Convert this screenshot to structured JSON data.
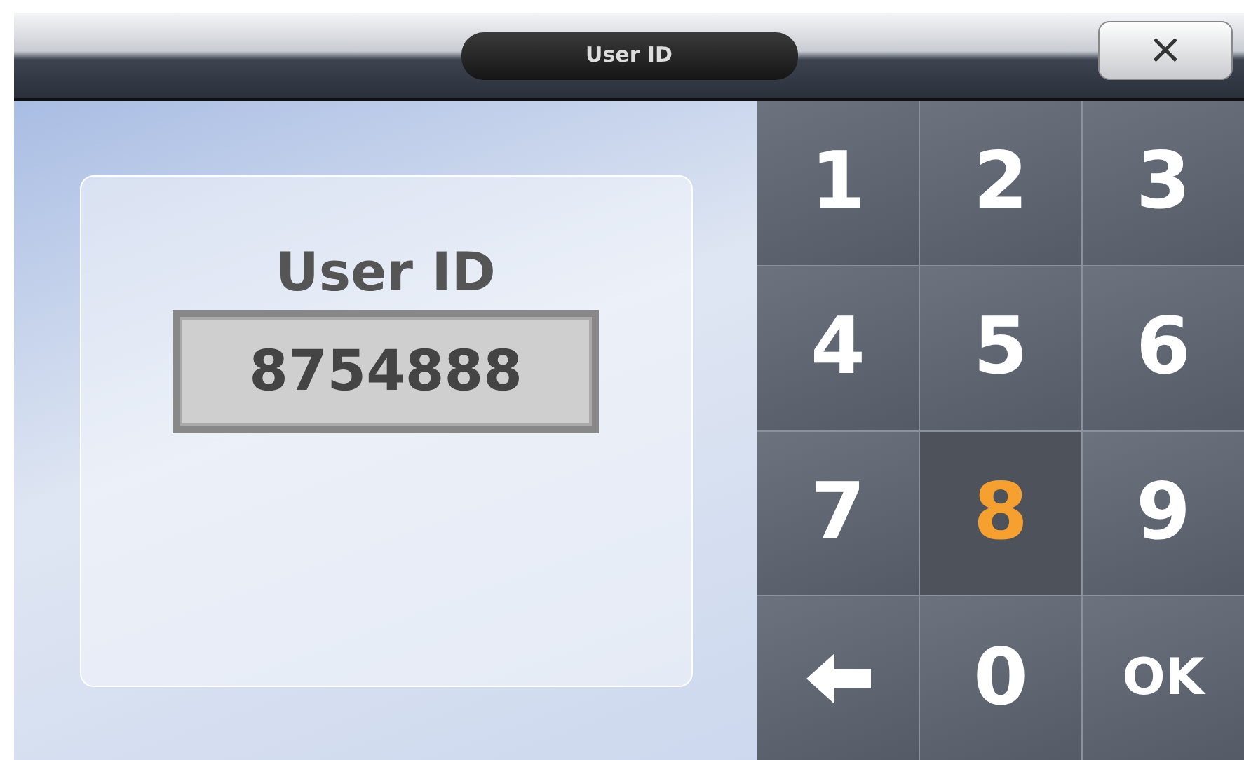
{
  "window": {
    "title": "User ID",
    "close_label": "×"
  },
  "entry": {
    "label": "User ID",
    "value": "8754888"
  },
  "keypad": [
    {
      "kind": "digit",
      "label": "1",
      "selected": false
    },
    {
      "kind": "digit",
      "label": "2",
      "selected": false
    },
    {
      "kind": "digit",
      "label": "3",
      "selected": false
    },
    {
      "kind": "digit",
      "label": "4",
      "selected": false
    },
    {
      "kind": "digit",
      "label": "5",
      "selected": false
    },
    {
      "kind": "digit",
      "label": "6",
      "selected": false
    },
    {
      "kind": "digit",
      "label": "7",
      "selected": false
    },
    {
      "kind": "digit",
      "label": "8",
      "selected": true
    },
    {
      "kind": "digit",
      "label": "9",
      "selected": false
    },
    {
      "kind": "backspace",
      "selected": false
    },
    {
      "kind": "digit",
      "label": "0",
      "selected": false
    },
    {
      "kind": "ok",
      "label": "OK",
      "selected": false
    }
  ]
}
